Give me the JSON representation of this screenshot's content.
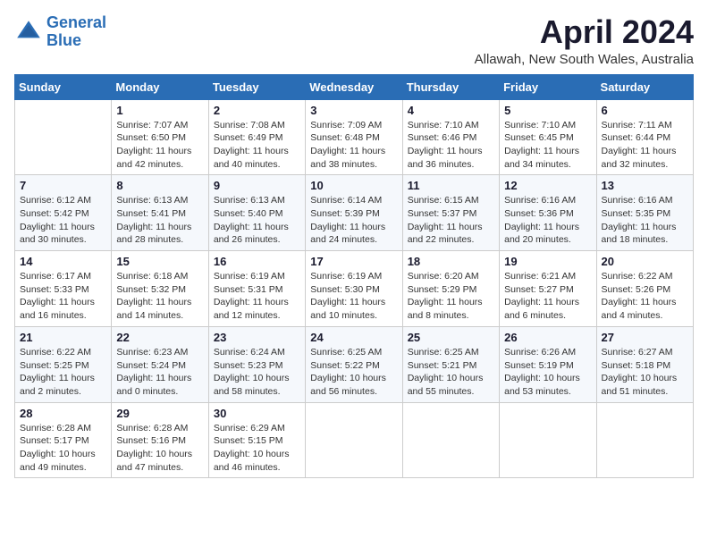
{
  "logo": {
    "line1": "General",
    "line2": "Blue"
  },
  "title": "April 2024",
  "subtitle": "Allawah, New South Wales, Australia",
  "weekdays": [
    "Sunday",
    "Monday",
    "Tuesday",
    "Wednesday",
    "Thursday",
    "Friday",
    "Saturday"
  ],
  "weeks": [
    [
      {
        "day": "",
        "info": ""
      },
      {
        "day": "1",
        "info": "Sunrise: 7:07 AM\nSunset: 6:50 PM\nDaylight: 11 hours\nand 42 minutes."
      },
      {
        "day": "2",
        "info": "Sunrise: 7:08 AM\nSunset: 6:49 PM\nDaylight: 11 hours\nand 40 minutes."
      },
      {
        "day": "3",
        "info": "Sunrise: 7:09 AM\nSunset: 6:48 PM\nDaylight: 11 hours\nand 38 minutes."
      },
      {
        "day": "4",
        "info": "Sunrise: 7:10 AM\nSunset: 6:46 PM\nDaylight: 11 hours\nand 36 minutes."
      },
      {
        "day": "5",
        "info": "Sunrise: 7:10 AM\nSunset: 6:45 PM\nDaylight: 11 hours\nand 34 minutes."
      },
      {
        "day": "6",
        "info": "Sunrise: 7:11 AM\nSunset: 6:44 PM\nDaylight: 11 hours\nand 32 minutes."
      }
    ],
    [
      {
        "day": "7",
        "info": "Sunrise: 6:12 AM\nSunset: 5:42 PM\nDaylight: 11 hours\nand 30 minutes."
      },
      {
        "day": "8",
        "info": "Sunrise: 6:13 AM\nSunset: 5:41 PM\nDaylight: 11 hours\nand 28 minutes."
      },
      {
        "day": "9",
        "info": "Sunrise: 6:13 AM\nSunset: 5:40 PM\nDaylight: 11 hours\nand 26 minutes."
      },
      {
        "day": "10",
        "info": "Sunrise: 6:14 AM\nSunset: 5:39 PM\nDaylight: 11 hours\nand 24 minutes."
      },
      {
        "day": "11",
        "info": "Sunrise: 6:15 AM\nSunset: 5:37 PM\nDaylight: 11 hours\nand 22 minutes."
      },
      {
        "day": "12",
        "info": "Sunrise: 6:16 AM\nSunset: 5:36 PM\nDaylight: 11 hours\nand 20 minutes."
      },
      {
        "day": "13",
        "info": "Sunrise: 6:16 AM\nSunset: 5:35 PM\nDaylight: 11 hours\nand 18 minutes."
      }
    ],
    [
      {
        "day": "14",
        "info": "Sunrise: 6:17 AM\nSunset: 5:33 PM\nDaylight: 11 hours\nand 16 minutes."
      },
      {
        "day": "15",
        "info": "Sunrise: 6:18 AM\nSunset: 5:32 PM\nDaylight: 11 hours\nand 14 minutes."
      },
      {
        "day": "16",
        "info": "Sunrise: 6:19 AM\nSunset: 5:31 PM\nDaylight: 11 hours\nand 12 minutes."
      },
      {
        "day": "17",
        "info": "Sunrise: 6:19 AM\nSunset: 5:30 PM\nDaylight: 11 hours\nand 10 minutes."
      },
      {
        "day": "18",
        "info": "Sunrise: 6:20 AM\nSunset: 5:29 PM\nDaylight: 11 hours\nand 8 minutes."
      },
      {
        "day": "19",
        "info": "Sunrise: 6:21 AM\nSunset: 5:27 PM\nDaylight: 11 hours\nand 6 minutes."
      },
      {
        "day": "20",
        "info": "Sunrise: 6:22 AM\nSunset: 5:26 PM\nDaylight: 11 hours\nand 4 minutes."
      }
    ],
    [
      {
        "day": "21",
        "info": "Sunrise: 6:22 AM\nSunset: 5:25 PM\nDaylight: 11 hours\nand 2 minutes."
      },
      {
        "day": "22",
        "info": "Sunrise: 6:23 AM\nSunset: 5:24 PM\nDaylight: 11 hours\nand 0 minutes."
      },
      {
        "day": "23",
        "info": "Sunrise: 6:24 AM\nSunset: 5:23 PM\nDaylight: 10 hours\nand 58 minutes."
      },
      {
        "day": "24",
        "info": "Sunrise: 6:25 AM\nSunset: 5:22 PM\nDaylight: 10 hours\nand 56 minutes."
      },
      {
        "day": "25",
        "info": "Sunrise: 6:25 AM\nSunset: 5:21 PM\nDaylight: 10 hours\nand 55 minutes."
      },
      {
        "day": "26",
        "info": "Sunrise: 6:26 AM\nSunset: 5:19 PM\nDaylight: 10 hours\nand 53 minutes."
      },
      {
        "day": "27",
        "info": "Sunrise: 6:27 AM\nSunset: 5:18 PM\nDaylight: 10 hours\nand 51 minutes."
      }
    ],
    [
      {
        "day": "28",
        "info": "Sunrise: 6:28 AM\nSunset: 5:17 PM\nDaylight: 10 hours\nand 49 minutes."
      },
      {
        "day": "29",
        "info": "Sunrise: 6:28 AM\nSunset: 5:16 PM\nDaylight: 10 hours\nand 47 minutes."
      },
      {
        "day": "30",
        "info": "Sunrise: 6:29 AM\nSunset: 5:15 PM\nDaylight: 10 hours\nand 46 minutes."
      },
      {
        "day": "",
        "info": ""
      },
      {
        "day": "",
        "info": ""
      },
      {
        "day": "",
        "info": ""
      },
      {
        "day": "",
        "info": ""
      }
    ]
  ]
}
